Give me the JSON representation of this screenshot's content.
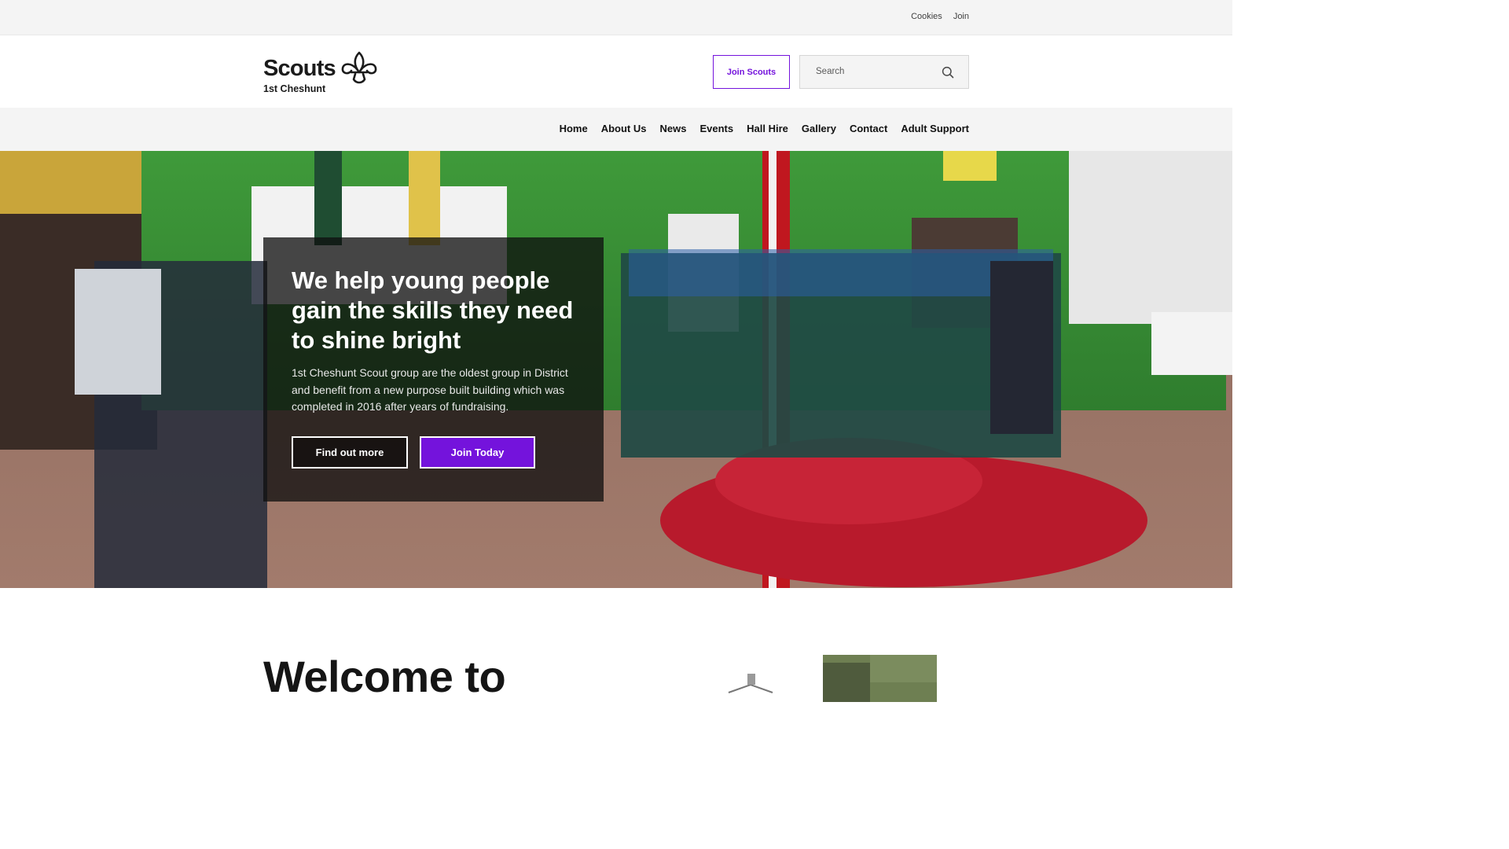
{
  "topbar": {
    "links": [
      "Cookies",
      "Join"
    ]
  },
  "brand": {
    "name": "Scouts",
    "group": "1st Cheshunt",
    "logo_icon": "fleur-de-lis-icon"
  },
  "header": {
    "join_button": "Join Scouts",
    "search_placeholder": "Search",
    "search_icon": "search-icon"
  },
  "nav": {
    "items": [
      "Home",
      "About Us",
      "News",
      "Events",
      "Hall Hire",
      "Gallery",
      "Contact",
      "Adult Support"
    ]
  },
  "hero": {
    "title": "We help young people gain the skills they need to shine bright",
    "text": "1st Cheshunt Scout group are the oldest group in District and benefit from a new purpose built building which was completed in 2016 after years of fundraising.",
    "buttons": {
      "find_out_more": "Find out more",
      "join_today": "Join Today"
    }
  },
  "welcome": {
    "heading": "Welcome to"
  },
  "colors": {
    "accent": "#7413dc",
    "topbar_bg": "#f4f4f4",
    "nav_bg": "#f4f4f4"
  }
}
